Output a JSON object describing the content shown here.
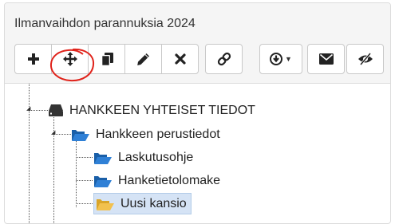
{
  "panel": {
    "title": "Ilmanvaihdon parannuksia 2024"
  },
  "toolbar": {
    "buttons": [
      {
        "id": "add",
        "icon": "plus-icon"
      },
      {
        "id": "move",
        "icon": "move-arrows-icon"
      },
      {
        "id": "copy",
        "icon": "copy-icon"
      },
      {
        "id": "rename",
        "icon": "pencil-icon"
      },
      {
        "id": "delete",
        "icon": "close-icon"
      },
      {
        "id": "link",
        "icon": "link-icon"
      },
      {
        "id": "download",
        "icon": "download-circle-icon"
      },
      {
        "id": "email",
        "icon": "envelope-icon"
      },
      {
        "id": "hide",
        "icon": "eye-slash-icon"
      }
    ]
  },
  "tree": {
    "root": {
      "label": "HANKKEEN YHTEISET TIEDOT",
      "icon": "drive-icon"
    },
    "folder": {
      "label": "Hankkeen perustiedot",
      "icon": "folder-open-icon"
    },
    "children": [
      {
        "label": "Laskutusohje",
        "icon": "folder-open-icon"
      },
      {
        "label": "Hanketietolomake",
        "icon": "folder-open-icon"
      },
      {
        "label": "Uusi kansio",
        "icon": "folder-open-icon",
        "selected": true
      }
    ]
  },
  "colors": {
    "folder_blue": "#1f6fc5",
    "folder_yellow": "#f2c14e",
    "selection": "#d5e3f5",
    "annotation_red": "#e0231b"
  }
}
